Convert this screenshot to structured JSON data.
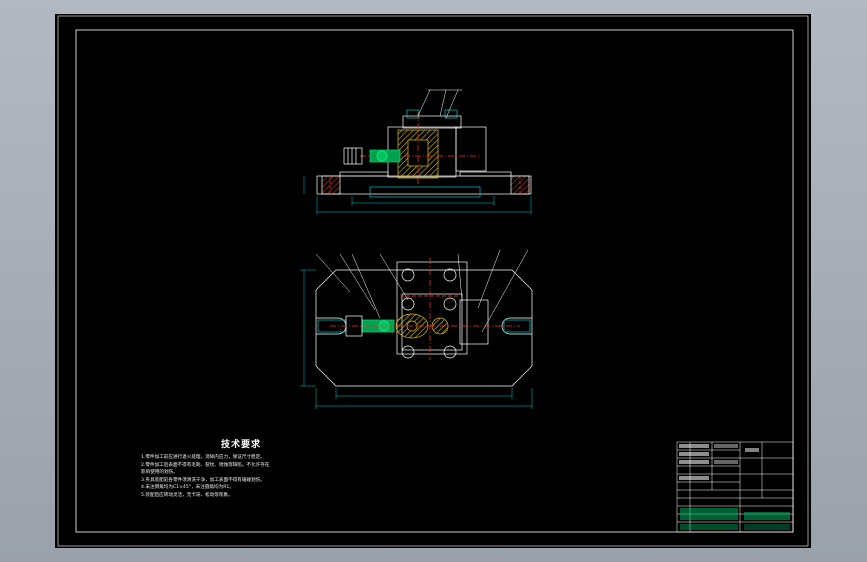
{
  "drawing": {
    "technical_requirements": {
      "title": "技术要求",
      "lines": [
        "1.零件加工前应进行退火处理，消除内应力，保证尺寸稳定。",
        "2.零件加工后表面不得有毛刺、裂纹、锈蚀等缺陷，不允许存在",
        "   影响使用的划伤。",
        "3.夹具装配前各零件须清洗干净，加工表面不得有磕碰划伤。",
        "4.未注倒角均为C1×45°，未注圆角均为R1。",
        "5.装配后应转动灵活，无卡滞、松动等现象。"
      ]
    },
    "colors": {
      "sheet": "#000000",
      "border": "#ffffff",
      "outline": "#ffffff",
      "dimension": "#00c8c8",
      "center_line": "#ff3030",
      "leader": "#ffffff",
      "hatch": "#e0c000",
      "green_part": "#00c060",
      "title_block_green": "#00b060"
    }
  }
}
